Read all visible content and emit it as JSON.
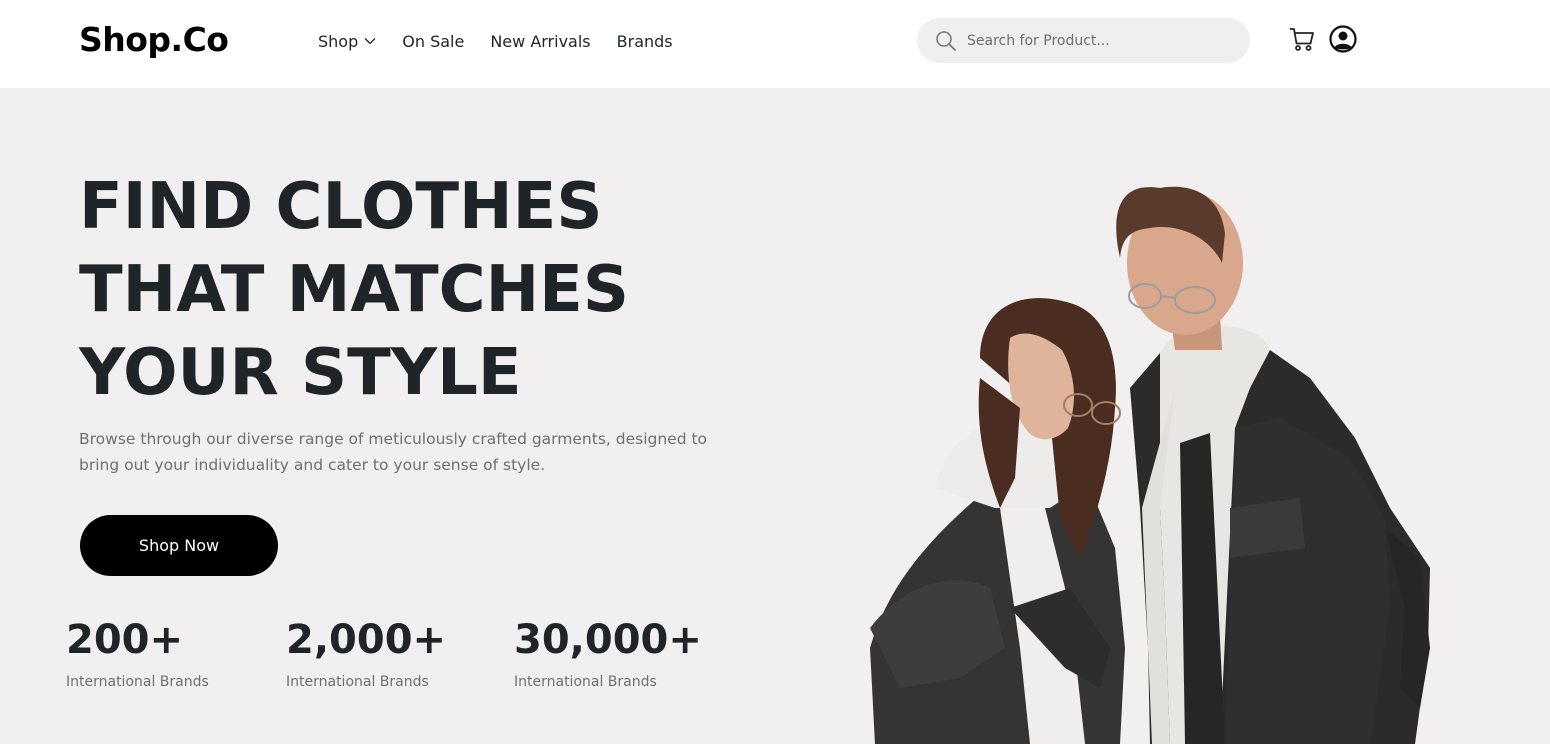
{
  "brand": {
    "logo_text": "Shop.Co"
  },
  "nav": {
    "items": [
      {
        "label": "Shop",
        "has_dropdown": true,
        "icon": "chevron-down-icon"
      },
      {
        "label": "On Sale"
      },
      {
        "label": "New Arrivals"
      },
      {
        "label": "Brands"
      }
    ]
  },
  "search": {
    "placeholder": "Search for Product...",
    "value": "",
    "icon": "search-icon"
  },
  "header_icons": {
    "cart": "cart-icon",
    "account": "user-account-icon"
  },
  "hero": {
    "headline_lines": [
      "FIND CLOTHES",
      "THAT MATCHES",
      "YOUR STYLE"
    ],
    "description_lines": [
      "Browse through our diverse range of meticulously crafted garments, designed to",
      "bring out your individuality and cater to your sense of style."
    ],
    "cta_label": "Shop Now",
    "stats": [
      {
        "value": "200+",
        "label": "International Brands"
      },
      {
        "value": "2,000+",
        "label": "International Brands"
      },
      {
        "value": "30,000+",
        "label": "International Brands"
      }
    ],
    "image_subject": "couple wearing black denim jackets over white hoodies"
  },
  "colors": {
    "hero_background": "#f1eff0",
    "text_dark": "#1f2429",
    "text_muted": "#6f6f6f",
    "button_background": "#000000",
    "button_text": "#ffffff",
    "search_background": "#efefef"
  }
}
